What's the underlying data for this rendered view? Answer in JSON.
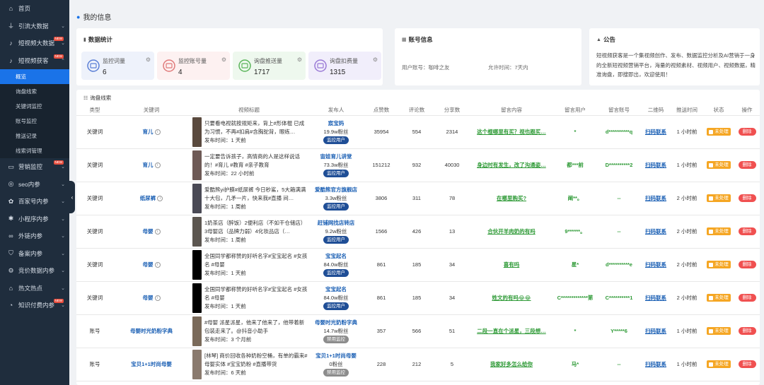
{
  "sidebar": {
    "items": [
      {
        "label": "首页",
        "icon": "home-icon"
      },
      {
        "label": "引流大数据",
        "icon": "funnel-icon",
        "chevron": true
      },
      {
        "label": "短视频大数据",
        "icon": "tiktok-icon",
        "chevron": true,
        "badge": "NEW"
      },
      {
        "label": "短视频获客",
        "icon": "tiktok-icon",
        "chevron": true,
        "badge": "NEW",
        "expanded": true
      }
    ],
    "subitems": [
      "概览",
      "询盘线索",
      "关键词监控",
      "账号监控",
      "推送记录",
      "线索词管理"
    ],
    "items_after": [
      {
        "label": "营销监控",
        "icon": "monitor-icon",
        "chevron": true,
        "badge": "NEW"
      },
      {
        "label": "seo内参",
        "icon": "seo-icon",
        "chevron": true
      },
      {
        "label": "百家号内参",
        "icon": "paw-icon",
        "chevron": true
      },
      {
        "label": "小程序内参",
        "icon": "miniprogram-icon",
        "chevron": true
      },
      {
        "label": "外链内参",
        "icon": "link-icon",
        "chevron": true
      },
      {
        "label": "备案内参",
        "icon": "shield-icon",
        "chevron": true
      },
      {
        "label": "竞价数据内参",
        "icon": "bidding-icon",
        "chevron": true
      },
      {
        "label": "热文热点",
        "icon": "hot-icon",
        "chevron": true
      },
      {
        "label": "知识付费内参",
        "icon": "knowledge-icon",
        "chevron": true,
        "badge": "NEW"
      }
    ]
  },
  "page_title": "我的信息",
  "stats_card": {
    "title": "数据统计",
    "stats": [
      {
        "label": "监控词量",
        "value": "6",
        "bg": "#eef2fb",
        "color": "#5b7fd6"
      },
      {
        "label": "监控账号量",
        "value": "4",
        "bg": "#fdf1f1",
        "color": "#e07a7a"
      },
      {
        "label": "询盘推送量",
        "value": "1717",
        "bg": "#eef8ee",
        "color": "#5bb55b"
      },
      {
        "label": "询盘扣费量",
        "value": "1315",
        "bg": "#f1eefb",
        "color": "#9a7ad6"
      }
    ]
  },
  "account_card": {
    "title": "账号信息",
    "user_label": "用户账号：咖啡之友",
    "time_label": "允许时间：7天内"
  },
  "notice_card": {
    "title": "公告",
    "text": "短视频获客是一个集视频创作、发布、数据监控分析及AI营销于一身的全新短视频营销平台，海量的视频素材、视频用户、视频数据，精准询盘，即搜即出，欢迎使用！"
  },
  "table_card": {
    "title": "询盘线索",
    "columns": [
      "类型",
      "关键词",
      "视频标题",
      "发布人",
      "点赞数",
      "评论数",
      "分享数",
      "留言内容",
      "留言用户",
      "留言账号",
      "二维码",
      "推送时间",
      "状态",
      "操作"
    ],
    "rows": [
      {
        "type": "关键词",
        "keyword": "育儿",
        "info": true,
        "thumb": "#5a4a3e",
        "title": "只要看电视就按规矩来，背上#形体棍 已成为习惯，不再#扣肩#含胸驼背，眼练…",
        "pub_time": "发布时间：1 天前",
        "publisher": "宸宝妈",
        "fans": "19.9w粉丝",
        "pill": "监控用户",
        "pill_grey": false,
        "likes": "35954",
        "comments": "554",
        "shares": "2314",
        "comment": "这个棍哪里有买？视也跟买…",
        "cuser": "*",
        "caccount": "d**********q",
        "qr": "扫码联系",
        "push_time": "1 小时前",
        "status": "未处理",
        "action": "删除"
      },
      {
        "type": "关键词",
        "keyword": "育儿",
        "info": true,
        "thumb": "#6e5a56",
        "title": "一定要告诉孩子，高情商的人是这样说话的！#育儿 #教育 #亲子教育",
        "pub_time": "发布时间：22 小时前",
        "publisher": "宙娃育儿讲堂",
        "fans": "73.3w粉丝",
        "pill": "监控用户",
        "pill_grey": false,
        "likes": "151212",
        "comments": "932",
        "shares": "40030",
        "comment": "身边时有发生，改了沟通姿…",
        "cuser": "都***前",
        "caccount": "D**********2",
        "qr": "扫码联系",
        "push_time": "1 小时前",
        "status": "未处理",
        "action": "删除"
      },
      {
        "type": "关键词",
        "keyword": "纸尿裤",
        "info": true,
        "thumb": "#4a4a55",
        "title": "爱酷熊yi护膜#纸尿裤 今日秒鲨，5大箱满满十大包，几矛一片，快来我#直播 间…",
        "pub_time": "发布时间：1 周前",
        "publisher": "爱酷熊官方旗舰店",
        "fans": "3.3w粉丝",
        "pill": "监控用户",
        "pill_grey": false,
        "likes": "3806",
        "comments": "311",
        "shares": "78",
        "comment": "在哪里购买?",
        "cuser": "阐**。",
        "caccount": "--",
        "qr": "扫码联系",
        "push_time": "2 小时前",
        "status": "未处理",
        "action": "删除"
      },
      {
        "type": "关键词",
        "keyword": "母婴",
        "info": true,
        "thumb": "#5c5650",
        "title": "1奶茶店（醉饭）2便利店（不如干仓储店）3母婴店（品牌力弱）4化妆品店（…",
        "pub_time": "发布时间：1 周前",
        "publisher": "赶铺网找店转店",
        "fans": "9.2w粉丝",
        "pill": "监控用户",
        "pill_grey": false,
        "likes": "1566",
        "comments": "426",
        "shares": "13",
        "comment": "合伙开羊肉奶的有吗",
        "cuser": "9******。",
        "caccount": "--",
        "qr": "扫码联系",
        "push_time": "2 小时前",
        "status": "未处理",
        "action": "删除"
      },
      {
        "type": "关键词",
        "keyword": "母婴",
        "info": true,
        "thumb": "#000000",
        "title": "全国同学都称赞的好听名字#宝宝起名 #女孩名 #母婴",
        "pub_time": "发布时间：1 天前",
        "publisher": "宝宝起名",
        "fans": "84.0w粉丝",
        "pill": "监控用户",
        "pill_grey": false,
        "likes": "861",
        "comments": "185",
        "shares": "34",
        "comment": "喜有吗",
        "cuser": "星*",
        "caccount": "d**********e",
        "qr": "扫码联系",
        "push_time": "2 小时前",
        "status": "未处理",
        "action": "删除"
      },
      {
        "type": "关键词",
        "keyword": "母婴",
        "info": true,
        "thumb": "#000000",
        "title": "全国同学都称赞的好听名字#宝宝起名 #女孩名 #母婴",
        "pub_time": "发布时间：1 天前",
        "publisher": "宝宝起名",
        "fans": "84.0w粉丝",
        "pill": "监控用户",
        "pill_grey": false,
        "likes": "861",
        "comments": "185",
        "shares": "34",
        "comment": "姓文的有吗😂😂",
        "cuser": "C*************第",
        "caccount": "C**********1",
        "qr": "扫码联系",
        "push_time": "2 小时前",
        "status": "未处理",
        "action": "删除"
      },
      {
        "type": "账号",
        "keyword": "母婴时光奶粉字典",
        "info": false,
        "thumb": "#7a6a5a",
        "title": "#母婴 派星派星，他来了他来了，他带着新包装走来了。@抖音小助手",
        "pub_time": "发布时间：3 个月前",
        "publisher": "母婴时光奶粉字典",
        "fans": "14.7w粉丝",
        "pill": "禁用监控",
        "pill_grey": true,
        "likes": "357",
        "comments": "566",
        "shares": "51",
        "comment": "二段一直在个派星，三段想…",
        "cuser": "*",
        "caccount": "Y*****6",
        "qr": "扫码联系",
        "push_time": "1 小时前",
        "status": "未处理",
        "action": "删除"
      },
      {
        "type": "账号",
        "keyword": "宝贝1+1时尚母婴",
        "info": false,
        "thumb": "#8a7a6e",
        "title": "[林琴] 商价回收各种奶粉空桶，有单的霸来#母婴实体 #宝宝奶粉 #直播带货",
        "pub_time": "发布时间：6 天前",
        "publisher": "宝贝1+1时尚母婴",
        "fans": "0粉丝",
        "pill": "禁用监控",
        "pill_grey": true,
        "likes": "228",
        "comments": "212",
        "shares": "5",
        "comment": "我家好多怎么给你",
        "cuser": "马*",
        "caccount": "--",
        "qr": "扫码联系",
        "push_time": "1 小时前",
        "status": "未处理",
        "action": "删除"
      }
    ]
  }
}
